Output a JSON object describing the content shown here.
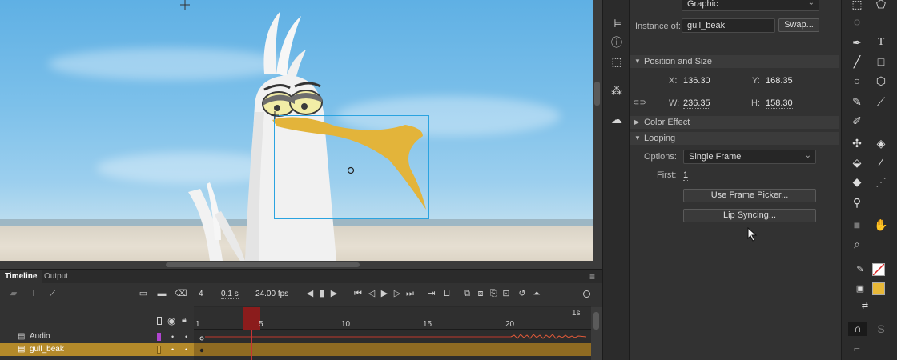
{
  "properties": {
    "symbol_type": "Graphic",
    "instance_of_label": "Instance of:",
    "instance_name": "gull_beak",
    "swap_label": "Swap...",
    "position_section": "Position and Size",
    "x_label": "X:",
    "x_value": "136.30",
    "y_label": "Y:",
    "y_value": "168.35",
    "w_label": "W:",
    "w_value": "236.35",
    "h_label": "H:",
    "h_value": "158.30",
    "color_effect_section": "Color Effect",
    "looping_section": "Looping",
    "options_label": "Options:",
    "options_value": "Single Frame",
    "first_label": "First:",
    "first_value": "1",
    "frame_picker_label": "Use Frame Picker...",
    "lip_sync_label": "Lip Syncing..."
  },
  "timeline": {
    "tab_timeline": "Timeline",
    "tab_output": "Output",
    "current_frame": "4",
    "elapsed": "0.1",
    "elapsed_unit": "s",
    "fps": "24.00",
    "fps_unit": "fps",
    "ruler": [
      "1",
      "5",
      "10",
      "15",
      "20"
    ],
    "ruler_seconds": "1s",
    "layers": [
      {
        "name": "Audio",
        "color": "#b044d0"
      },
      {
        "name": "gull_beak",
        "color": "#d4a640"
      }
    ]
  },
  "colors": {
    "beak": "#e3b43a",
    "selection": "#2aa3e0",
    "fill_swatch": "#e8b838",
    "playhead": "#c83333"
  }
}
